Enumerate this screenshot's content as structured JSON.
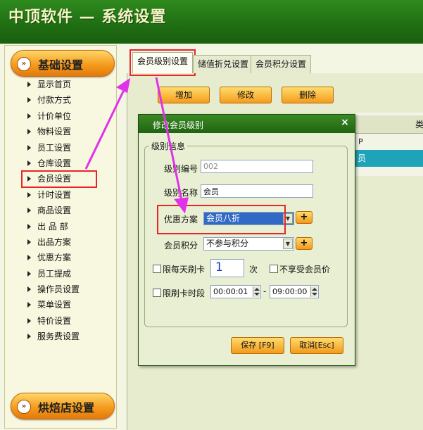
{
  "app": {
    "title": "中顶软件 — 系统设置"
  },
  "sidebar": {
    "section_basic": "基础设置",
    "section_bakery": "烘焙店设置",
    "items": [
      {
        "label": "显示首页"
      },
      {
        "label": "付款方式"
      },
      {
        "label": "计价单位"
      },
      {
        "label": "物料设置"
      },
      {
        "label": "员工设置"
      },
      {
        "label": "仓库设置"
      },
      {
        "label": "会员设置",
        "active": true
      },
      {
        "label": "计时设置"
      },
      {
        "label": "商品设置"
      },
      {
        "label": "出 品 部"
      },
      {
        "label": "出品方案"
      },
      {
        "label": "优惠方案"
      },
      {
        "label": "员工提成"
      },
      {
        "label": "操作员设置"
      },
      {
        "label": "菜单设置"
      },
      {
        "label": "特价设置"
      },
      {
        "label": "服务费设置"
      }
    ]
  },
  "tabs": [
    {
      "label": "会员级别设置",
      "active": true
    },
    {
      "label": "储值折兑设置"
    },
    {
      "label": "会员积分设置"
    }
  ],
  "toolbar": {
    "add": "增加",
    "edit": "修改",
    "delete": "删除"
  },
  "grid": {
    "header_partial": "类",
    "row1_partial": "P",
    "row2_partial": "员"
  },
  "dialog": {
    "title": "修改会员级别",
    "close_glyph": "×",
    "group_label": "级别信息",
    "level_no_label": "级别编号",
    "level_no_value": "002",
    "level_name_label": "级别名称",
    "level_name_value": "会员",
    "scheme_label": "优惠方案",
    "scheme_value": "会员八折",
    "points_label": "会员积分",
    "points_value": "不参与积分",
    "plus": "+",
    "daily_limit_label": "限每天刷卡",
    "daily_limit_value": "1",
    "times_unit": "次",
    "no_member_price_label": "不享受会员价",
    "time_limit_label": "限刷卡时段",
    "time_from": "00:00:01",
    "time_sep": "-",
    "time_to": "09:00:00",
    "save_label": "保存 [F9]",
    "cancel_label": "取消[Esc]"
  },
  "colors": {
    "accent_red": "#e8262a",
    "arrow_magenta": "#e032e8",
    "header_green": "#1f6d12",
    "button_orange": "#f59b1e"
  }
}
